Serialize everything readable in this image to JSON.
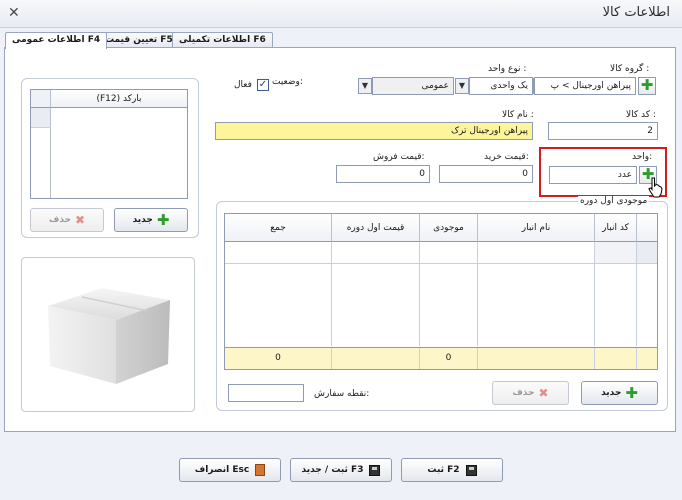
{
  "window": {
    "title": "اطلاعات کالا",
    "close_glyph": "✕"
  },
  "tabs": [
    {
      "label": "اطلاعات عمومی F4",
      "active": true
    },
    {
      "label": "تعیین قیمت F5",
      "active": false
    },
    {
      "label": "اطلاعات تکمیلی F6",
      "active": false
    }
  ],
  "form": {
    "group_label": "گروه کالا :",
    "group_value": "پیراهن اورجینال > پ",
    "unit_type_label": "نوع واحد :",
    "unit_type_value": "یک واحدی",
    "general_value": "عمومی",
    "status_label": "وضعیت:",
    "active_label": "فعال",
    "active_checked": "✓",
    "code_label": "کد کالا :",
    "code_value": "2",
    "name_label": "نام کالا :",
    "name_value": "پیراهن اورجینال ترک",
    "unit_label": "واحد:",
    "unit_value": "عدد",
    "buy_price_label": "قیمت خرید:",
    "buy_price_value": "0",
    "sell_price_label": "قیمت فروش:",
    "sell_price_value": "0",
    "reorder_label": "نقطه سفارش:",
    "reorder_value": ""
  },
  "barcode": {
    "header": "(F12) بارکد",
    "new_label": "جدید",
    "delete_label": "حذف"
  },
  "inventory": {
    "group_title": "موجودی اول دوره",
    "columns": [
      "کد انبار",
      "نام انبار",
      "موجودی",
      "قیمت اول دوره",
      "جمع"
    ],
    "totals": {
      "qty": "0",
      "sum": "0"
    },
    "new_label": "جدید",
    "delete_label": "حذف"
  },
  "footer": {
    "save_label": "ثبت F2",
    "save_new_label": "ثبت / جدید F3",
    "cancel_label": "انصراف Esc"
  },
  "colors": {
    "highlight": "#d11f1f",
    "field_yellow": "#fdf59a",
    "plus_green": "#2e9b2e"
  }
}
